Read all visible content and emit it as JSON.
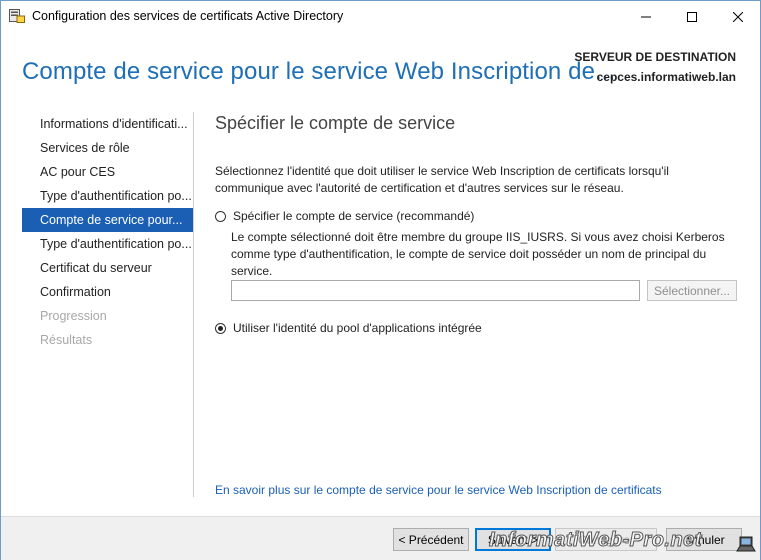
{
  "window": {
    "title": "Configuration des services de certificats Active Directory",
    "minimize_glyph": "—",
    "maximize_glyph": "☐",
    "close_glyph": "✕"
  },
  "header": {
    "title": "Compte de service pour le service Web Inscription de...",
    "destination_label": "SERVEUR DE DESTINATION",
    "destination_server": "cepces.informatiweb.lan"
  },
  "nav": {
    "items": [
      {
        "label": "Informations d'identificati...",
        "state": "normal"
      },
      {
        "label": "Services de rôle",
        "state": "normal"
      },
      {
        "label": "AC pour CES",
        "state": "normal"
      },
      {
        "label": "Type d'authentification po...",
        "state": "normal"
      },
      {
        "label": "Compte de service pour...",
        "state": "active"
      },
      {
        "label": "Type d'authentification po...",
        "state": "normal"
      },
      {
        "label": "Certificat du serveur",
        "state": "normal"
      },
      {
        "label": "Confirmation",
        "state": "normal"
      },
      {
        "label": "Progression",
        "state": "disabled"
      },
      {
        "label": "Résultats",
        "state": "disabled"
      }
    ]
  },
  "content": {
    "title": "Spécifier le compte de service",
    "description": "Sélectionnez l'identité que doit utiliser le service Web Inscription de certificats lorsqu'il communique avec l'autorité de certification et d'autres services sur le réseau.",
    "option_specify": {
      "label": "Spécifier le compte de service (recommandé)",
      "checked": false,
      "note": "Le compte sélectionné doit être membre du groupe IIS_IUSRS. Si vous avez choisi Kerberos comme type d'authentification, le compte de service doit posséder un nom de principal du service.",
      "account_value": "",
      "select_button": "Sélectionner..."
    },
    "option_pool": {
      "label": "Utiliser l'identité du pool d'applications intégrée",
      "checked": true
    },
    "help_link": "En savoir plus sur le compte de service pour le service Web Inscription de certificats"
  },
  "footer": {
    "prev_label": "< Précédent",
    "next_label": "Suivant >",
    "install_label": "Configurer",
    "cancel_label": "Annuler"
  },
  "watermark": "InformatiWeb-Pro.net",
  "colors": {
    "accent": "#1a5fb4",
    "header_title": "#1e6fb5",
    "disabled_text": "#a8a8a8"
  }
}
